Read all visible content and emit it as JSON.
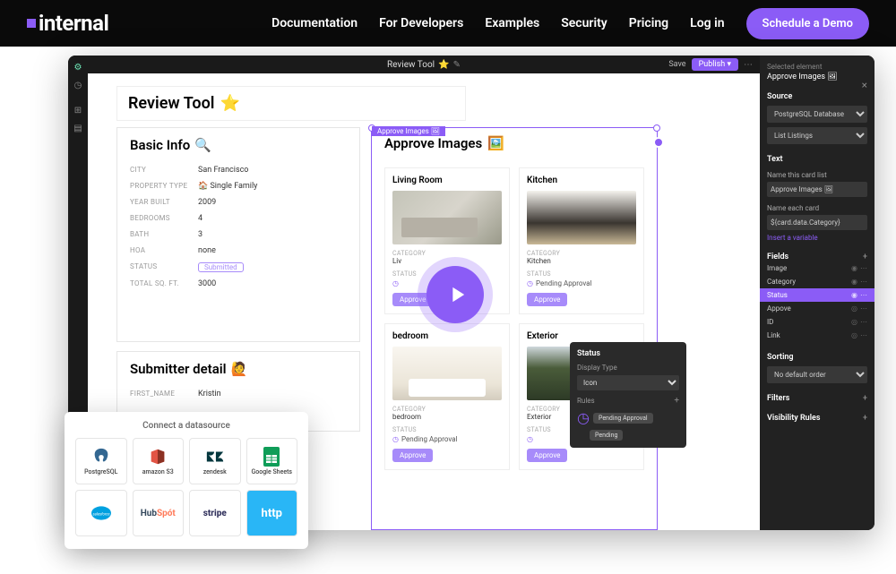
{
  "nav": {
    "brand": "internal",
    "items": [
      "Documentation",
      "For Developers",
      "Examples",
      "Security",
      "Pricing",
      "Log in"
    ],
    "cta": "Schedule a Demo"
  },
  "editor": {
    "title": "Review Tool",
    "title_emoji": "⭐",
    "save": "Save",
    "publish": "Publish"
  },
  "page": {
    "title": "Review Tool",
    "title_emoji": "⭐"
  },
  "basic_info": {
    "header": "Basic Info",
    "header_icon": "🔍",
    "rows": [
      {
        "label": "CITY",
        "value": "San Francisco"
      },
      {
        "label": "PROPERTY TYPE",
        "value": "🏠 Single Family"
      },
      {
        "label": "YEAR BUILT",
        "value": "2009"
      },
      {
        "label": "BEDROOMS",
        "value": "4"
      },
      {
        "label": "BATH",
        "value": "3"
      },
      {
        "label": "HOA",
        "value": "none"
      },
      {
        "label": "STATUS",
        "value": "Submitted",
        "chip": true
      },
      {
        "label": "TOTAL SQ. FT.",
        "value": "3000"
      }
    ]
  },
  "submitter": {
    "header": "Submitter detail",
    "header_icon": "🙋",
    "rows": [
      {
        "label": "FIRST_NAME",
        "value": "Kristin"
      }
    ]
  },
  "approve": {
    "tag": "Approve Images 🖼",
    "header": "Approve Images",
    "header_icon": "🖼️",
    "btn_label": "Approve",
    "status_label": "STATUS",
    "category_label": "CATEGORY",
    "pending": "Pending Approval",
    "cards": [
      {
        "title": "Living Room",
        "category": "Liv"
      },
      {
        "title": "Kitchen",
        "category": "Kitchen"
      },
      {
        "title": "bedroom",
        "category": "bedroom"
      },
      {
        "title": "Exterior",
        "category": "Exterior"
      }
    ]
  },
  "status_popover": {
    "title": "Status",
    "display_type_label": "Display Type",
    "display_type_value": "Icon",
    "rules_label": "Rules",
    "rules": [
      "Pending Approval",
      "Pending"
    ]
  },
  "right_panel": {
    "selected_label": "Selected element",
    "selected_value": "Approve Images 🖼",
    "source_header": "Source",
    "source_db": "PostgreSQL Database",
    "source_table": "List Listings",
    "text_header": "Text",
    "name_list_label": "Name this card list",
    "name_list_value": "Approve Images 🖼",
    "name_card_label": "Name each card",
    "name_card_value": "${card.data.Category}",
    "insert_var": "Insert a variable",
    "fields_header": "Fields",
    "fields": [
      "Image",
      "Category",
      "Status",
      "Appove",
      "ID",
      "Link"
    ],
    "active_field": "Status",
    "sorting_header": "Sorting",
    "sorting_value": "No default order",
    "filters_header": "Filters",
    "visibility_header": "Visibility Rules"
  },
  "datasource": {
    "header": "Connect a datasource",
    "items": [
      "PostgreSQL",
      "amazon S3",
      "zendesk",
      "Google Sheets",
      "salesforce",
      "HubSpot",
      "stripe",
      "http"
    ]
  }
}
